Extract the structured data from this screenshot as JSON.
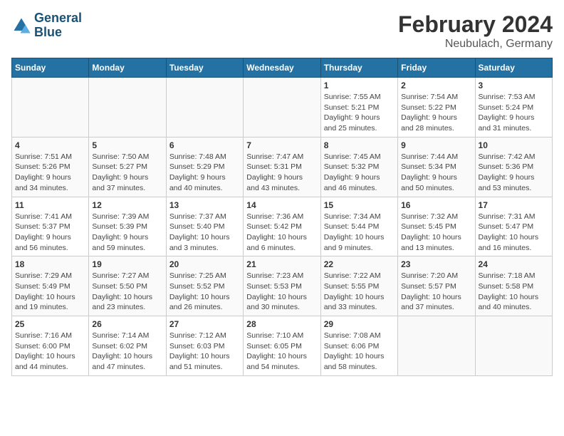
{
  "header": {
    "logo_line1": "General",
    "logo_line2": "Blue",
    "month_title": "February 2024",
    "subtitle": "Neubulach, Germany"
  },
  "calendar": {
    "days_of_week": [
      "Sunday",
      "Monday",
      "Tuesday",
      "Wednesday",
      "Thursday",
      "Friday",
      "Saturday"
    ],
    "weeks": [
      [
        {
          "day": "",
          "info": ""
        },
        {
          "day": "",
          "info": ""
        },
        {
          "day": "",
          "info": ""
        },
        {
          "day": "",
          "info": ""
        },
        {
          "day": "1",
          "info": "Sunrise: 7:55 AM\nSunset: 5:21 PM\nDaylight: 9 hours\nand 25 minutes."
        },
        {
          "day": "2",
          "info": "Sunrise: 7:54 AM\nSunset: 5:22 PM\nDaylight: 9 hours\nand 28 minutes."
        },
        {
          "day": "3",
          "info": "Sunrise: 7:53 AM\nSunset: 5:24 PM\nDaylight: 9 hours\nand 31 minutes."
        }
      ],
      [
        {
          "day": "4",
          "info": "Sunrise: 7:51 AM\nSunset: 5:26 PM\nDaylight: 9 hours\nand 34 minutes."
        },
        {
          "day": "5",
          "info": "Sunrise: 7:50 AM\nSunset: 5:27 PM\nDaylight: 9 hours\nand 37 minutes."
        },
        {
          "day": "6",
          "info": "Sunrise: 7:48 AM\nSunset: 5:29 PM\nDaylight: 9 hours\nand 40 minutes."
        },
        {
          "day": "7",
          "info": "Sunrise: 7:47 AM\nSunset: 5:31 PM\nDaylight: 9 hours\nand 43 minutes."
        },
        {
          "day": "8",
          "info": "Sunrise: 7:45 AM\nSunset: 5:32 PM\nDaylight: 9 hours\nand 46 minutes."
        },
        {
          "day": "9",
          "info": "Sunrise: 7:44 AM\nSunset: 5:34 PM\nDaylight: 9 hours\nand 50 minutes."
        },
        {
          "day": "10",
          "info": "Sunrise: 7:42 AM\nSunset: 5:36 PM\nDaylight: 9 hours\nand 53 minutes."
        }
      ],
      [
        {
          "day": "11",
          "info": "Sunrise: 7:41 AM\nSunset: 5:37 PM\nDaylight: 9 hours\nand 56 minutes."
        },
        {
          "day": "12",
          "info": "Sunrise: 7:39 AM\nSunset: 5:39 PM\nDaylight: 9 hours\nand 59 minutes."
        },
        {
          "day": "13",
          "info": "Sunrise: 7:37 AM\nSunset: 5:40 PM\nDaylight: 10 hours\nand 3 minutes."
        },
        {
          "day": "14",
          "info": "Sunrise: 7:36 AM\nSunset: 5:42 PM\nDaylight: 10 hours\nand 6 minutes."
        },
        {
          "day": "15",
          "info": "Sunrise: 7:34 AM\nSunset: 5:44 PM\nDaylight: 10 hours\nand 9 minutes."
        },
        {
          "day": "16",
          "info": "Sunrise: 7:32 AM\nSunset: 5:45 PM\nDaylight: 10 hours\nand 13 minutes."
        },
        {
          "day": "17",
          "info": "Sunrise: 7:31 AM\nSunset: 5:47 PM\nDaylight: 10 hours\nand 16 minutes."
        }
      ],
      [
        {
          "day": "18",
          "info": "Sunrise: 7:29 AM\nSunset: 5:49 PM\nDaylight: 10 hours\nand 19 minutes."
        },
        {
          "day": "19",
          "info": "Sunrise: 7:27 AM\nSunset: 5:50 PM\nDaylight: 10 hours\nand 23 minutes."
        },
        {
          "day": "20",
          "info": "Sunrise: 7:25 AM\nSunset: 5:52 PM\nDaylight: 10 hours\nand 26 minutes."
        },
        {
          "day": "21",
          "info": "Sunrise: 7:23 AM\nSunset: 5:53 PM\nDaylight: 10 hours\nand 30 minutes."
        },
        {
          "day": "22",
          "info": "Sunrise: 7:22 AM\nSunset: 5:55 PM\nDaylight: 10 hours\nand 33 minutes."
        },
        {
          "day": "23",
          "info": "Sunrise: 7:20 AM\nSunset: 5:57 PM\nDaylight: 10 hours\nand 37 minutes."
        },
        {
          "day": "24",
          "info": "Sunrise: 7:18 AM\nSunset: 5:58 PM\nDaylight: 10 hours\nand 40 minutes."
        }
      ],
      [
        {
          "day": "25",
          "info": "Sunrise: 7:16 AM\nSunset: 6:00 PM\nDaylight: 10 hours\nand 44 minutes."
        },
        {
          "day": "26",
          "info": "Sunrise: 7:14 AM\nSunset: 6:02 PM\nDaylight: 10 hours\nand 47 minutes."
        },
        {
          "day": "27",
          "info": "Sunrise: 7:12 AM\nSunset: 6:03 PM\nDaylight: 10 hours\nand 51 minutes."
        },
        {
          "day": "28",
          "info": "Sunrise: 7:10 AM\nSunset: 6:05 PM\nDaylight: 10 hours\nand 54 minutes."
        },
        {
          "day": "29",
          "info": "Sunrise: 7:08 AM\nSunset: 6:06 PM\nDaylight: 10 hours\nand 58 minutes."
        },
        {
          "day": "",
          "info": ""
        },
        {
          "day": "",
          "info": ""
        }
      ]
    ]
  }
}
